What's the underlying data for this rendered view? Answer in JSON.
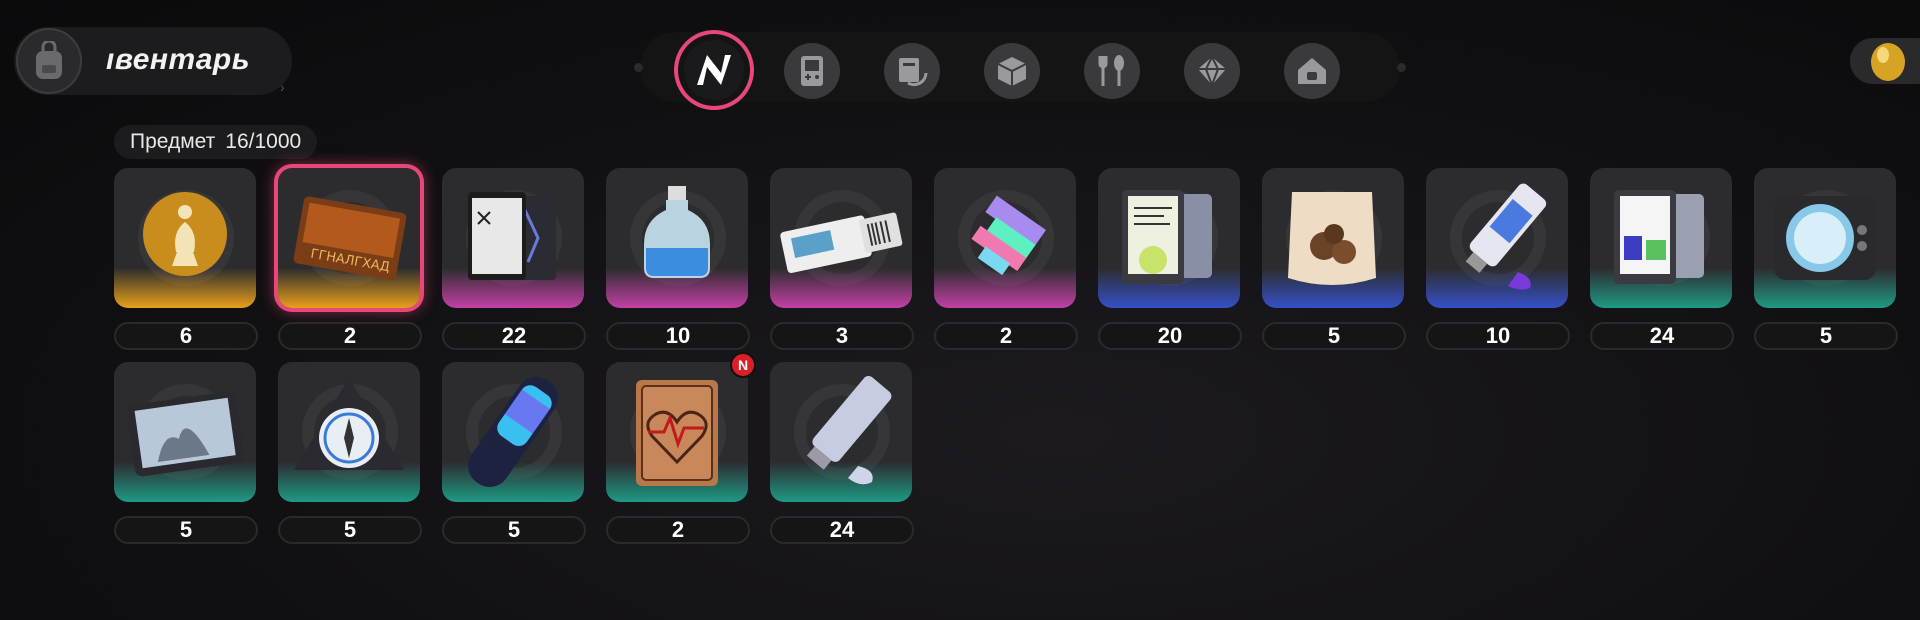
{
  "header": {
    "title": "ıвентарь",
    "tabs": [
      {
        "icon": "n-logo-icon",
        "active": true
      },
      {
        "icon": "handheld-console-icon"
      },
      {
        "icon": "disc-case-icon"
      },
      {
        "icon": "box-icon"
      },
      {
        "icon": "fork-spoon-icon"
      },
      {
        "icon": "gem-icon"
      },
      {
        "icon": "home-icon"
      }
    ]
  },
  "inventory": {
    "label": "Предмет",
    "count": "16/1000"
  },
  "colors": {
    "gold": "#e9a01a",
    "purple": "#c440a6",
    "blue": "#3550c8",
    "teal": "#1f9a86",
    "selected": "#e8477a"
  },
  "items": [
    {
      "icon": "golden-chess-piece-icon",
      "rarity": "gold",
      "qty": "6"
    },
    {
      "icon": "bronze-card-icon",
      "rarity": "gold",
      "qty": "2",
      "selected": true
    },
    {
      "icon": "magazine-icon",
      "rarity": "purple",
      "qty": "22"
    },
    {
      "icon": "potion-bottle-icon",
      "rarity": "purple",
      "qty": "10"
    },
    {
      "icon": "ticket-icon",
      "rarity": "purple",
      "qty": "3"
    },
    {
      "icon": "glitch-fragment-icon",
      "rarity": "purple",
      "qty": "2"
    },
    {
      "icon": "tablet-document-icon",
      "rarity": "blue",
      "qty": "20"
    },
    {
      "icon": "snack-bag-icon",
      "rarity": "blue",
      "qty": "5"
    },
    {
      "icon": "paint-tube-icon",
      "rarity": "blue",
      "qty": "10"
    },
    {
      "icon": "tablet-poster-icon",
      "rarity": "teal",
      "qty": "24"
    },
    {
      "icon": "camera-device-icon",
      "rarity": "teal",
      "qty": "5"
    },
    {
      "icon": "tablet-photo-icon",
      "rarity": "teal",
      "qty": "5"
    },
    {
      "icon": "compass-device-icon",
      "rarity": "teal",
      "qty": "5"
    },
    {
      "icon": "glow-cylinder-icon",
      "rarity": "teal",
      "qty": "5"
    },
    {
      "icon": "heartbeat-card-icon",
      "rarity": "teal",
      "qty": "2",
      "badge": "N"
    },
    {
      "icon": "silver-tube-icon",
      "rarity": "teal",
      "qty": "24"
    }
  ]
}
